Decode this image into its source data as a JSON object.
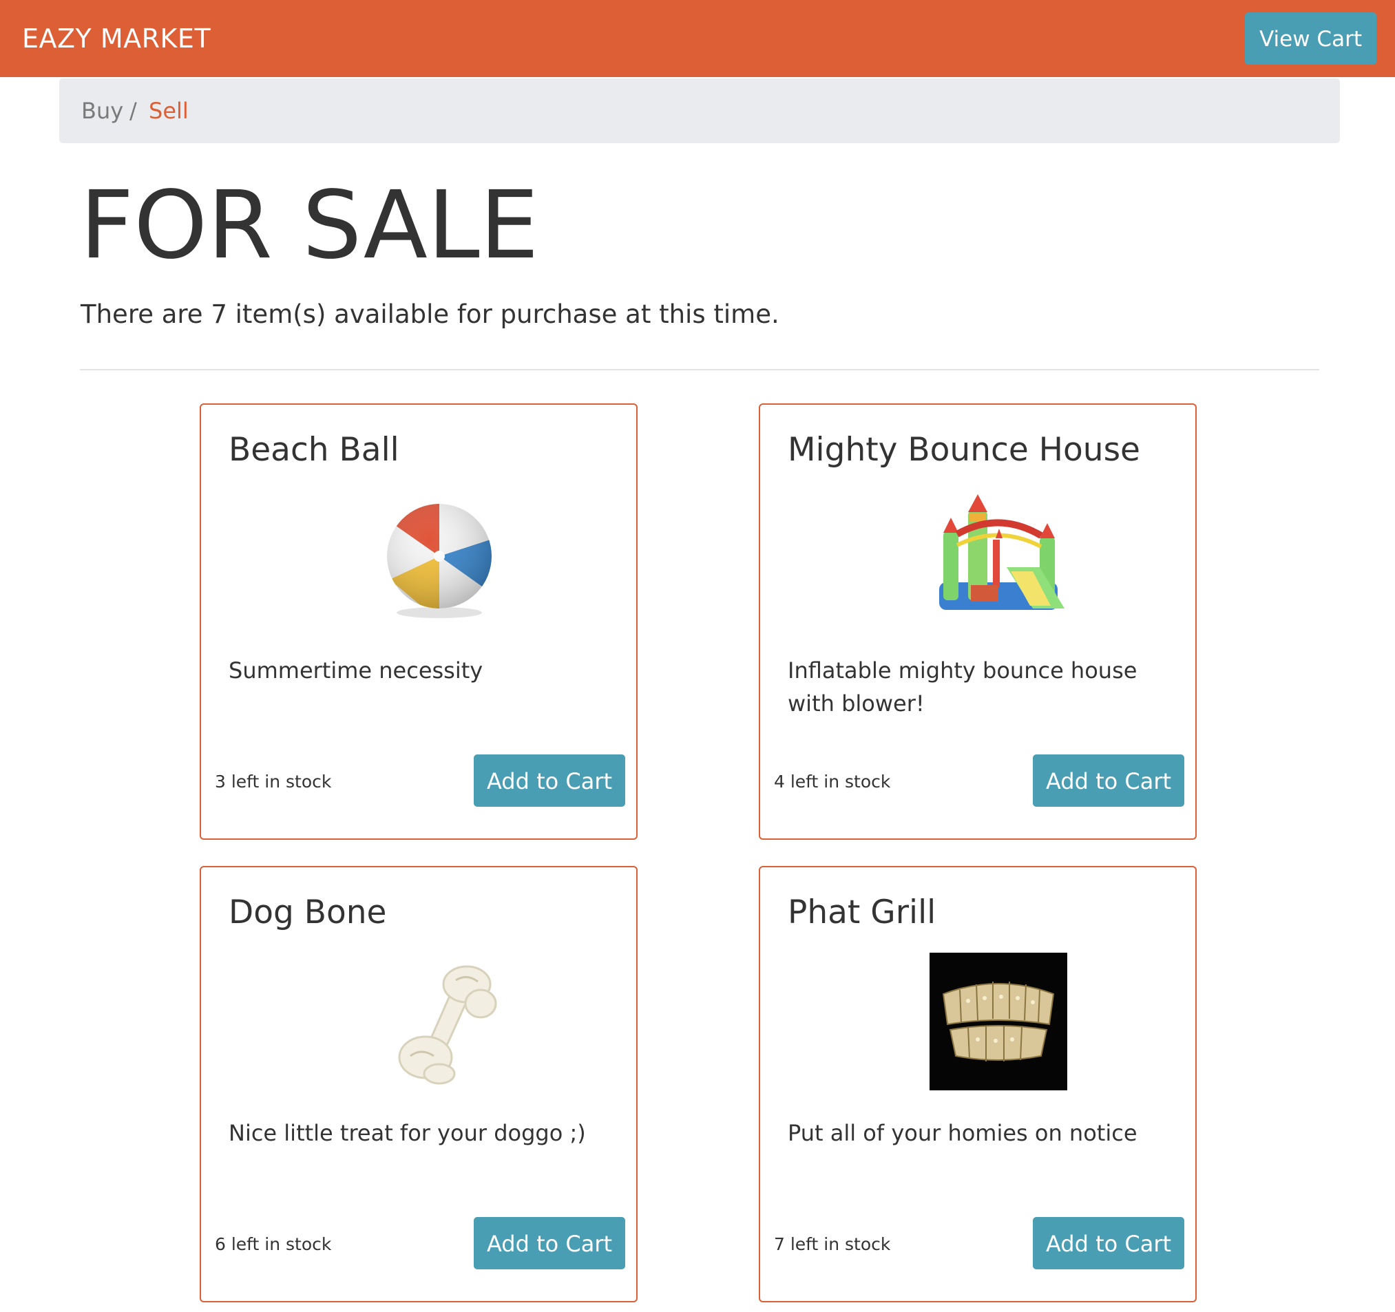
{
  "navbar": {
    "brand": "EAZY MARKET",
    "view_cart_label": "View Cart",
    "color": "#dc5f35"
  },
  "breadcrumb": {
    "buy": "Buy",
    "separator": "/",
    "sell": "Sell"
  },
  "main": {
    "title": "FOR SALE",
    "subtitle": "There are 7 item(s) available for purchase at this time."
  },
  "products": [
    {
      "name": "Beach Ball",
      "description": "Summertime necessity",
      "stock": "3 left in stock",
      "button": "Add to Cart",
      "image_icon": "beach-ball-image"
    },
    {
      "name": "Mighty Bounce House",
      "description": "Inflatable mighty bounce house with blower!",
      "stock": "4 left in stock",
      "button": "Add to Cart",
      "image_icon": "bounce-house-image"
    },
    {
      "name": "Dog Bone",
      "description": "Nice little treat for your doggo ;)",
      "stock": "6 left in stock",
      "button": "Add to Cart",
      "image_icon": "dog-bone-image"
    },
    {
      "name": "Phat Grill",
      "description": "Put all of your homies on notice",
      "stock": "7 left in stock",
      "button": "Add to Cart",
      "image_icon": "grill-image"
    }
  ],
  "colors": {
    "accent": "#dc5f35",
    "button": "#4a9eb3",
    "breadcrumb_bg": "#e9ebee"
  }
}
